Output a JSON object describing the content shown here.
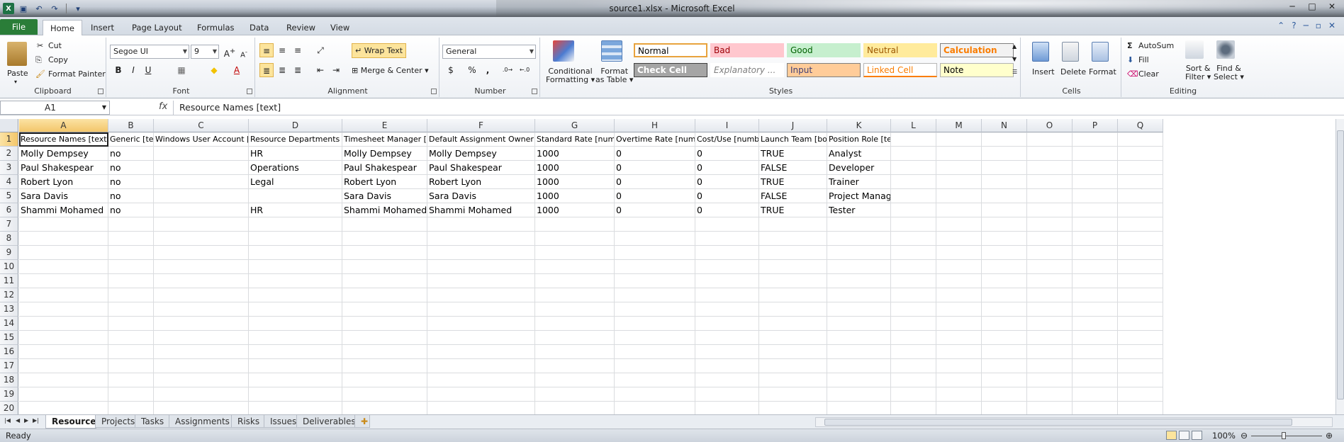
{
  "window": {
    "title": "source1.xlsx - Microsoft Excel",
    "controls": [
      "─",
      "□",
      "✕"
    ]
  },
  "ribbon_tabs": [
    "File",
    "Home",
    "Insert",
    "Page Layout",
    "Formulas",
    "Data",
    "Review",
    "View"
  ],
  "ribbon": {
    "clipboard": {
      "label": "Clipboard",
      "paste": "Paste",
      "cut": "Cut",
      "copy": "Copy",
      "format_painter": "Format Painter"
    },
    "font": {
      "label": "Font",
      "family": "Segoe UI",
      "size": "9",
      "bold": "B",
      "italic": "I",
      "underline": "U"
    },
    "alignment": {
      "label": "Alignment",
      "wrap_text": "Wrap Text",
      "merge_center": "Merge & Center"
    },
    "number": {
      "label": "Number",
      "format": "General",
      "percent": "%",
      "comma": ","
    },
    "styles": {
      "label": "Styles",
      "conditional_formatting": [
        "Conditional",
        "Formatting"
      ],
      "format_as_table": [
        "Format",
        "as Table"
      ],
      "cells": [
        {
          "name": "Normal",
          "bg": "#ffffff",
          "fg": "#000000",
          "border": "#e8a33d"
        },
        {
          "name": "Bad",
          "bg": "#ffc7ce",
          "fg": "#9c0006",
          "border": "#ffc7ce"
        },
        {
          "name": "Good",
          "bg": "#c6efce",
          "fg": "#006100",
          "border": "#c6efce"
        },
        {
          "name": "Neutral",
          "bg": "#ffeb9c",
          "fg": "#9c5700",
          "border": "#ffeb9c"
        },
        {
          "name": "Calculation",
          "bg": "#f2f2f2",
          "fg": "#fa7d00",
          "border": "#7f7f7f"
        },
        {
          "name": "Check Cell",
          "bg": "#a5a5a5",
          "fg": "#ffffff",
          "border": "#3f3f3f"
        },
        {
          "name": "Explanatory ...",
          "bg": "#ffffff",
          "fg": "#7f7f7f",
          "border": "#ffffff"
        },
        {
          "name": "Input",
          "bg": "#ffcc99",
          "fg": "#3f3f76",
          "border": "#7f7f7f"
        },
        {
          "name": "Linked Cell",
          "bg": "#ffffff",
          "fg": "#fa7d00",
          "border": "#ffffff"
        },
        {
          "name": "Note",
          "bg": "#ffffcc",
          "fg": "#000000",
          "border": "#b2b2b2"
        }
      ]
    },
    "cells_group": {
      "label": "Cells",
      "insert": "Insert",
      "delete": "Delete",
      "format": "Format"
    },
    "editing": {
      "label": "Editing",
      "autosum": "AutoSum",
      "fill": "Fill",
      "clear": "Clear",
      "sort_filter": [
        "Sort &",
        "Filter"
      ],
      "find_select": [
        "Find &",
        "Select"
      ]
    }
  },
  "formula_bar": {
    "name_box": "A1",
    "fx": "fx",
    "content": "Resource Names [text]"
  },
  "columns": [
    "A",
    "B",
    "C",
    "D",
    "E",
    "F",
    "G",
    "H",
    "I",
    "J",
    "K",
    "L",
    "M",
    "N",
    "O",
    "P",
    "Q"
  ],
  "row_numbers": [
    "1",
    "2",
    "3",
    "4",
    "5",
    "6",
    "7",
    "8",
    "9",
    "10",
    "11",
    "12",
    "13",
    "14",
    "15",
    "16",
    "17",
    "18",
    "19",
    "20"
  ],
  "sheet": {
    "headers": [
      "Resource Names [text]",
      "Generic [text]",
      "Windows User Account [text]",
      "Resource Departments [text]",
      "Timesheet Manager [text]",
      "Default Assignment Owner [text]",
      "Standard Rate [number]",
      "Overtime Rate [number]",
      "Cost/Use [number]",
      "Launch Team [bool]",
      "Position Role [text]"
    ],
    "rows": [
      [
        "Molly Dempsey",
        "no",
        "",
        "HR",
        "Molly Dempsey",
        "Molly Dempsey",
        "1000",
        "0",
        "0",
        "TRUE",
        "Analyst"
      ],
      [
        "Paul Shakespear",
        "no",
        "",
        "Operations",
        "Paul Shakespear",
        "Paul Shakespear",
        "1000",
        "0",
        "0",
        "FALSE",
        "Developer"
      ],
      [
        "Robert Lyon",
        "no",
        "",
        "Legal",
        "Robert Lyon",
        "Robert Lyon",
        "1000",
        "0",
        "0",
        "TRUE",
        "Trainer"
      ],
      [
        "Sara Davis",
        "no",
        "",
        "",
        "Sara Davis",
        "Sara Davis",
        "1000",
        "0",
        "0",
        "FALSE",
        "Project Manager"
      ],
      [
        "Shammi Mohamed",
        "no",
        "",
        "HR",
        "Shammi Mohamed",
        "Shammi Mohamed",
        "1000",
        "0",
        "0",
        "TRUE",
        "Tester"
      ]
    ]
  },
  "sheet_tabs": [
    "Resources",
    "Projects",
    "Tasks",
    "Assignments",
    "Risks",
    "Issues",
    "Deliverables"
  ],
  "active_sheet": "Resources",
  "status": {
    "text": "Ready",
    "zoom": "100%"
  }
}
